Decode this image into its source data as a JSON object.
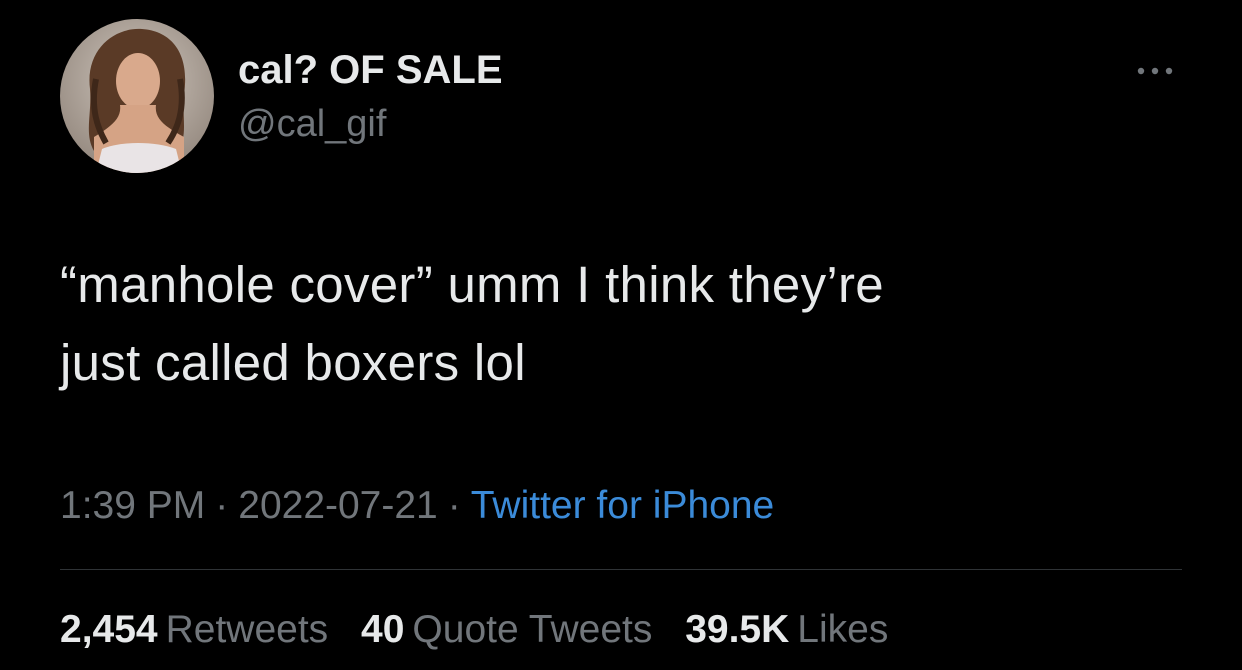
{
  "author": {
    "display_name": "cal? OF SALE",
    "handle": "@cal_gif",
    "avatar_icon": "profile-photo"
  },
  "menu": {
    "icon": "more-horizontal-icon",
    "glyph": "•••"
  },
  "tweet": {
    "text_line1": "“manhole cover” umm I think they’re",
    "text_line2": "just called boxers lol"
  },
  "meta": {
    "time": "1:39 PM",
    "separator": "·",
    "date": "2022-07-21",
    "source": "Twitter for iPhone"
  },
  "stats": {
    "retweets_count": "2,454",
    "retweets_label": "Retweets",
    "quotes_count": "40",
    "quotes_label": "Quote Tweets",
    "likes_count": "39.5K",
    "likes_label": "Likes"
  },
  "colors": {
    "background": "#000000",
    "primary_text": "#e7e9ea",
    "secondary_text": "#71767b",
    "link": "#3b8bd9",
    "divider": "#2f3336"
  }
}
